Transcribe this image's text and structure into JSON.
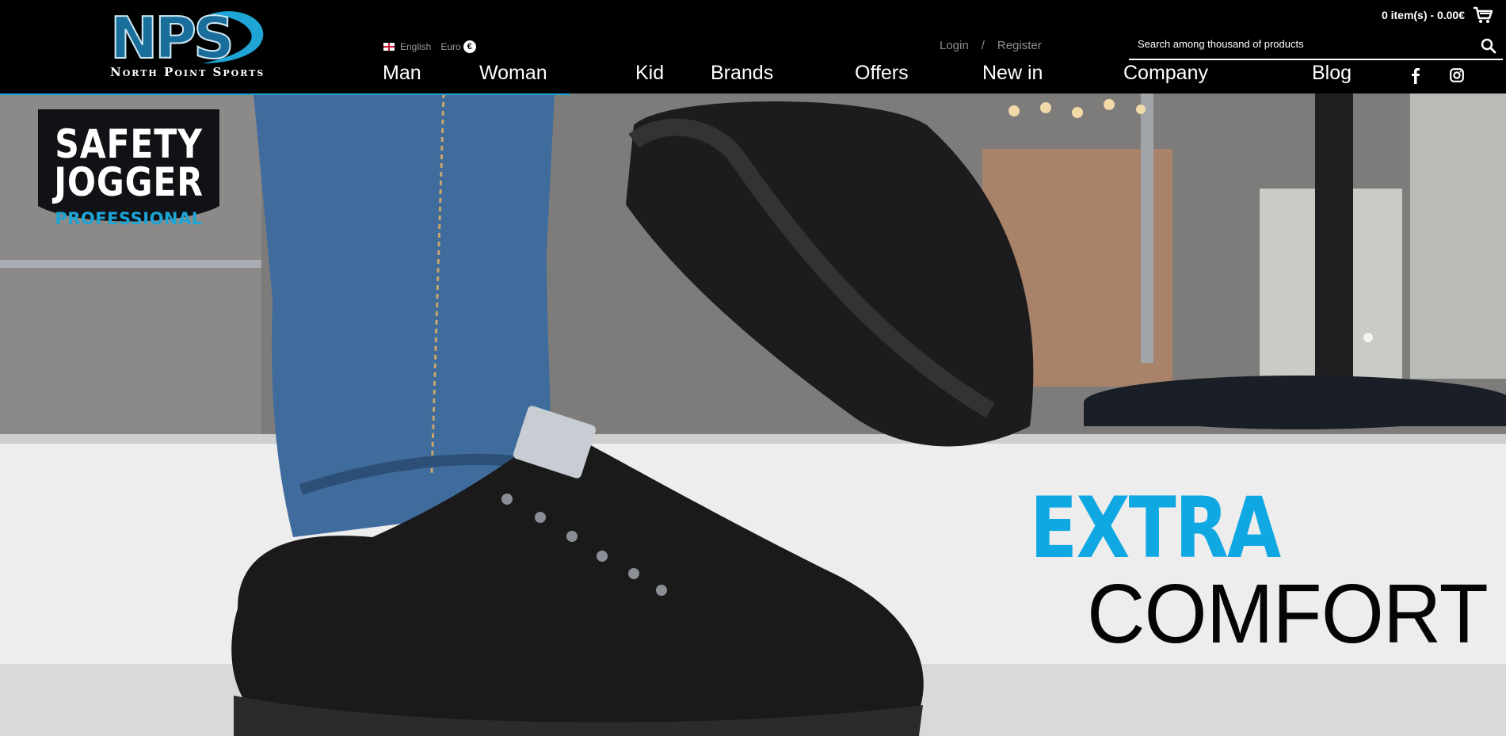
{
  "brand": {
    "logo_text": "NPS",
    "logo_subtitle": "North Point Sports"
  },
  "header": {
    "language": "English",
    "currency": "Euro",
    "currency_symbol": "€",
    "login": "Login",
    "separator": "/",
    "register": "Register",
    "cart_summary": "0 item(s) - 0.00€",
    "search_placeholder": "Search among thousand of products"
  },
  "nav": {
    "items": [
      "Man",
      "Woman",
      "Kid",
      "Brands",
      "Offers",
      "New in",
      "Company",
      "Blog"
    ]
  },
  "social": [
    "facebook-icon",
    "instagram-icon"
  ],
  "hero": {
    "badge_line1": "SAFETY",
    "badge_line2": "JOGGER",
    "badge_line3": "PROFESSIONAL",
    "tagline_accent": "EXTRA",
    "tagline_main": "COMFORT"
  },
  "colors": {
    "accent": "#1ea5d6",
    "tagline_accent": "#0fa8e3",
    "header_bg": "#000000"
  }
}
